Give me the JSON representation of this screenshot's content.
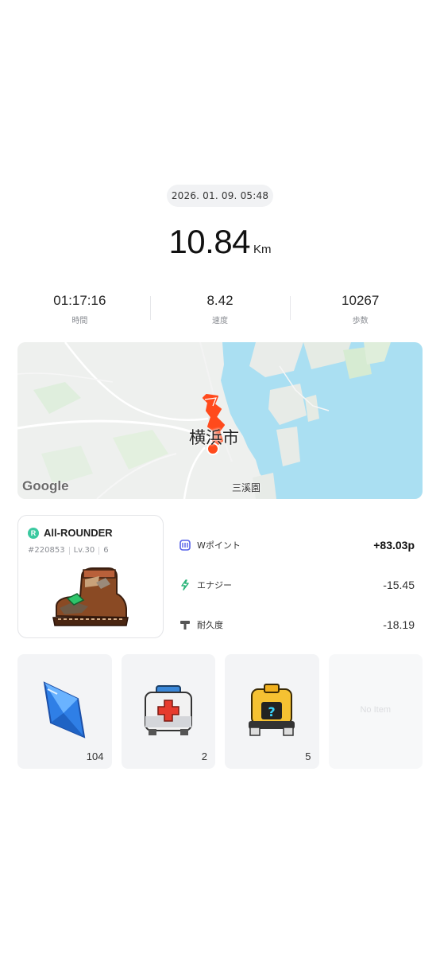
{
  "record": {
    "datetime": "2026. 01. 09. 05:48",
    "distance_value": "10.84",
    "distance_unit": "Km"
  },
  "stats": [
    {
      "value": "01:17:16",
      "label": "時間"
    },
    {
      "value": "8.42",
      "label": "速度"
    },
    {
      "value": "10267",
      "label": "歩数"
    }
  ],
  "map": {
    "city_label": "横浜市",
    "district_label": "三溪園",
    "logo_text": "Google",
    "route_color": "#ff4a1c"
  },
  "shoe": {
    "rarity_letter": "R",
    "type": "All-ROUNDER",
    "id": "#220853",
    "level": "Lv.30",
    "mint": "6"
  },
  "results": [
    {
      "icon": "w-point-icon",
      "name": "Wポイント",
      "amount": "+83.03p"
    },
    {
      "icon": "energy-bolt-icon",
      "name": "エナジー",
      "amount": "-15.45"
    },
    {
      "icon": "durability-hammer-icon",
      "name": "耐久度",
      "amount": "-18.19"
    }
  ],
  "items": [
    {
      "icon": "blue-gem-icon",
      "count": "104"
    },
    {
      "icon": "repair-kit-icon",
      "count": "2"
    },
    {
      "icon": "mystery-box-icon",
      "count": "5"
    },
    {
      "icon": "",
      "empty_text": "No Item"
    }
  ],
  "colors": {
    "accent_green": "#3bc9a0",
    "route_orange": "#ff4a1c",
    "water_blue": "#aadff2"
  }
}
